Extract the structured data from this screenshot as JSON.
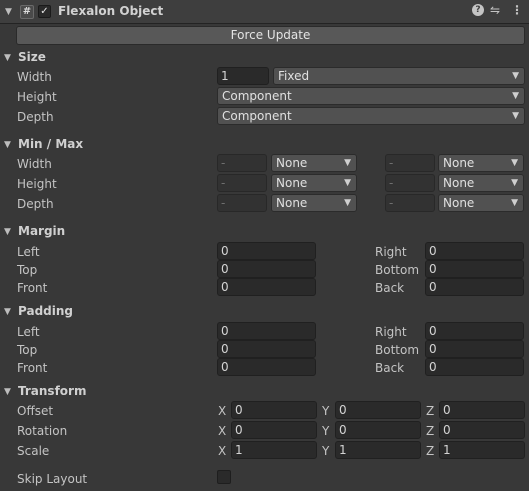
{
  "header": {
    "title": "Flexalon Object",
    "component_icon": "#",
    "enabled_check": "✓",
    "help_icon": "?",
    "settings_icon": "⇋",
    "menu_icon": "⋮"
  },
  "force_update_label": "Force Update",
  "size": {
    "title": "Size",
    "width_label": "Width",
    "width_value": "1",
    "width_mode": "Fixed",
    "height_label": "Height",
    "height_mode": "Component",
    "depth_label": "Depth",
    "depth_mode": "Component"
  },
  "minmax": {
    "title": "Min / Max",
    "width_label": "Width",
    "height_label": "Height",
    "depth_label": "Depth",
    "placeholder": "-",
    "none": "None"
  },
  "margin": {
    "title": "Margin",
    "left_label": "Left",
    "left": "0",
    "top_label": "Top",
    "top": "0",
    "front_label": "Front",
    "front": "0",
    "right_label": "Right",
    "right": "0",
    "bottom_label": "Bottom",
    "bottom": "0",
    "back_label": "Back",
    "back": "0"
  },
  "padding": {
    "title": "Padding",
    "left_label": "Left",
    "left": "0",
    "top_label": "Top",
    "top": "0",
    "front_label": "Front",
    "front": "0",
    "right_label": "Right",
    "right": "0",
    "bottom_label": "Bottom",
    "bottom": "0",
    "back_label": "Back",
    "back": "0"
  },
  "transform": {
    "title": "Transform",
    "axis_x": "X",
    "axis_y": "Y",
    "axis_z": "Z",
    "offset_label": "Offset",
    "offset": [
      "0",
      "0",
      "0"
    ],
    "rotation_label": "Rotation",
    "rotation": [
      "0",
      "0",
      "0"
    ],
    "scale_label": "Scale",
    "scale": [
      "1",
      "1",
      "1"
    ]
  },
  "skip_layout_label": "Skip Layout"
}
